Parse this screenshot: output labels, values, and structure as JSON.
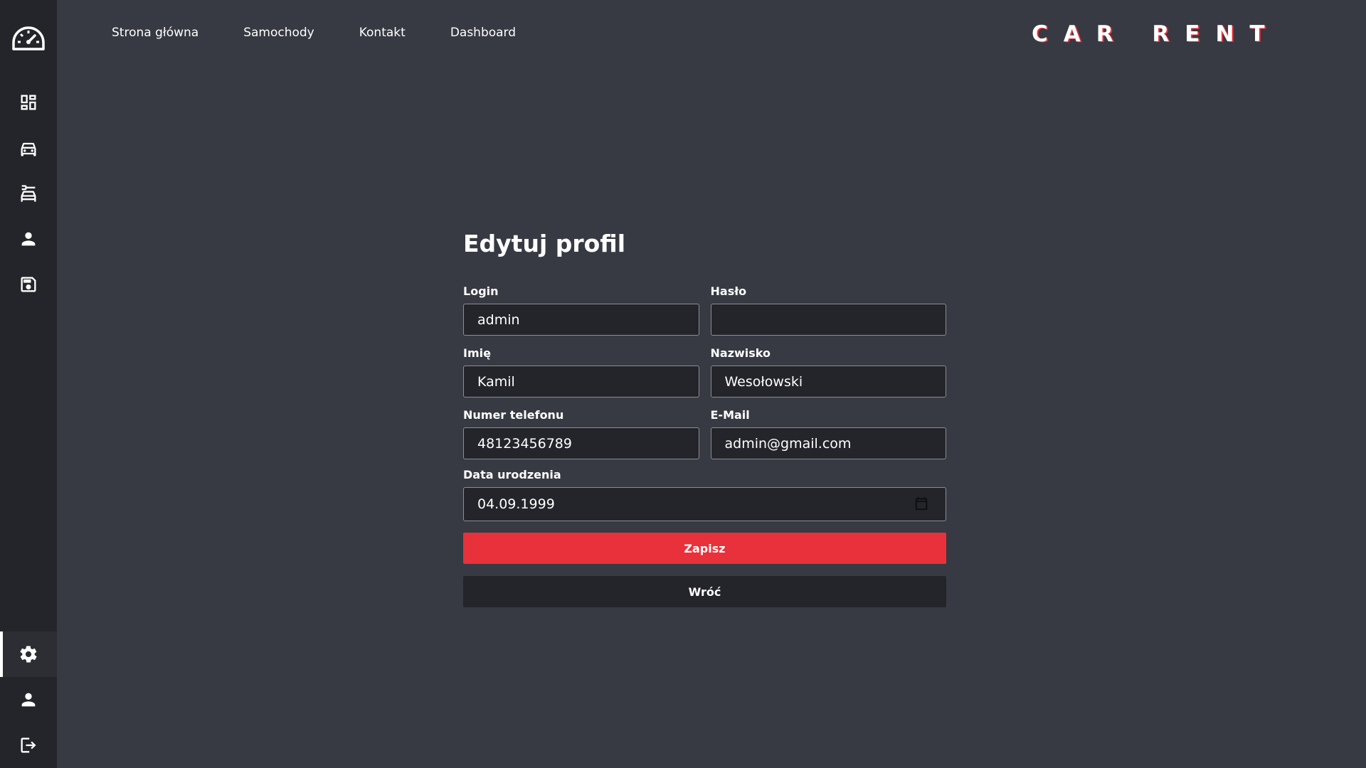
{
  "sidebar": {
    "logo_icon": "speedometer-icon",
    "items": [
      {
        "icon": "dashboard-grid-icon"
      },
      {
        "icon": "car-icon"
      },
      {
        "icon": "car-service-icon"
      },
      {
        "icon": "person-icon"
      },
      {
        "icon": "save-disk-icon"
      }
    ],
    "bottom_items": [
      {
        "icon": "gear-icon",
        "active": true
      },
      {
        "icon": "person-icon"
      },
      {
        "icon": "logout-icon"
      }
    ]
  },
  "nav": {
    "links": [
      "Strona główna",
      "Samochody",
      "Kontakt",
      "Dashboard"
    ]
  },
  "brand": {
    "text": "CAR RENT",
    "accent_color": "#e8313a"
  },
  "form": {
    "title": "Edytuj profil",
    "fields": {
      "login": {
        "label": "Login",
        "value": "admin"
      },
      "password": {
        "label": "Hasło",
        "value": ""
      },
      "first_name": {
        "label": "Imię",
        "value": "Kamil"
      },
      "last_name": {
        "label": "Nazwisko",
        "value": "Wesołowski"
      },
      "phone": {
        "label": "Numer telefonu",
        "value": "48123456789"
      },
      "email": {
        "label": "E-Mail",
        "value": "admin@gmail.com"
      },
      "birth_date": {
        "label": "Data urodzenia",
        "value": "04.09.1999"
      }
    },
    "save_label": "Zapisz",
    "back_label": "Wróć"
  },
  "colors": {
    "background": "#373a43",
    "sidebar": "#24252a",
    "primary": "#e8313a"
  }
}
